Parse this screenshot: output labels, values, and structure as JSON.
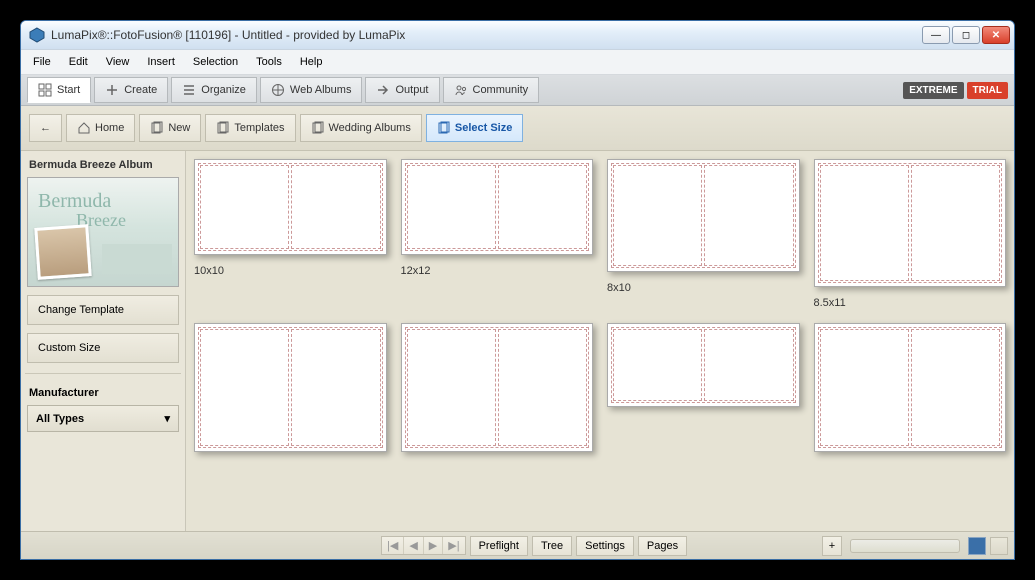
{
  "title": "LumaPix®::FotoFusion® [110196] - Untitled - provided by LumaPix",
  "menu": [
    "File",
    "Edit",
    "View",
    "Insert",
    "Selection",
    "Tools",
    "Help"
  ],
  "toolbar": {
    "tabs": [
      {
        "label": "Start",
        "active": true
      },
      {
        "label": "Create",
        "active": false
      },
      {
        "label": "Organize",
        "active": false
      },
      {
        "label": "Web Albums",
        "active": false
      },
      {
        "label": "Output",
        "active": false
      },
      {
        "label": "Community",
        "active": false
      }
    ],
    "badges": {
      "extreme": "EXTREME",
      "trial": "TRIAL"
    }
  },
  "breadcrumb": {
    "back": "←",
    "items": [
      {
        "label": "Home",
        "active": false
      },
      {
        "label": "New",
        "active": false
      },
      {
        "label": "Templates",
        "active": false
      },
      {
        "label": "Wedding Albums",
        "active": false
      },
      {
        "label": "Select Size",
        "active": true
      }
    ]
  },
  "sidebar": {
    "title": "Bermuda Breeze Album",
    "thumb_text1": "Bermuda",
    "thumb_text2": "Breeze",
    "change_template": "Change Template",
    "custom_size": "Custom Size",
    "manufacturer_header": "Manufacturer",
    "all_types": "All Types"
  },
  "sizes": [
    {
      "label": "10x10"
    },
    {
      "label": "12x12"
    },
    {
      "label": "8x10"
    },
    {
      "label": "8.5x11"
    },
    {
      "label": ""
    },
    {
      "label": ""
    },
    {
      "label": ""
    },
    {
      "label": ""
    }
  ],
  "status": {
    "nav": [
      "|◀",
      "◀",
      "▶",
      "▶|"
    ],
    "tabs": [
      "Preflight",
      "Tree",
      "Settings",
      "Pages"
    ],
    "plus": "+"
  }
}
